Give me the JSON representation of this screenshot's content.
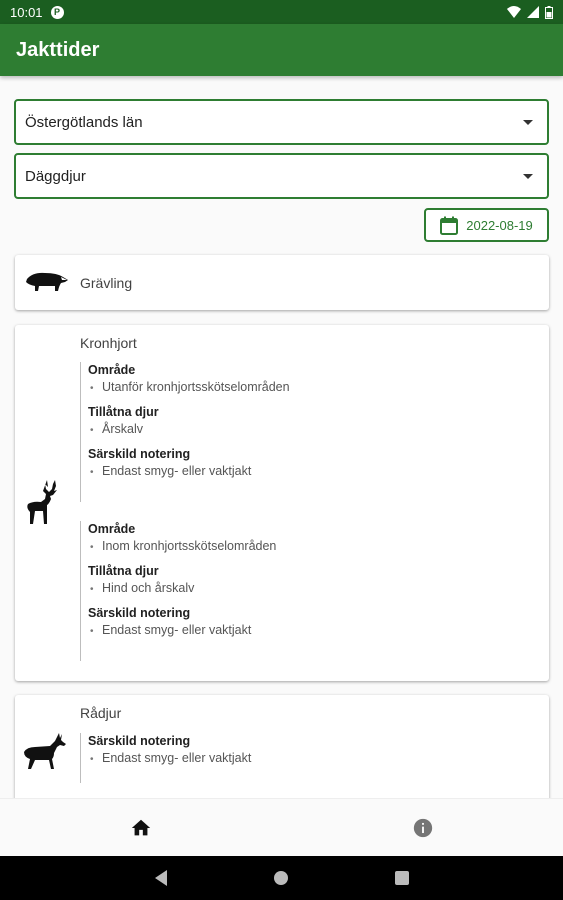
{
  "status_bar": {
    "time": "10:01",
    "app_badge": "P"
  },
  "app_bar": {
    "title": "Jakttider"
  },
  "filters": {
    "region": "Östergötlands län",
    "category": "Däggdjur",
    "date": "2022-08-19"
  },
  "icons": {
    "calendar": "calendar-icon",
    "home": "home-icon",
    "info": "info-icon",
    "dropdown": "arrow-drop-down-icon"
  },
  "colors": {
    "primary": "#2e7d32",
    "status_bar": "#1b5e20"
  },
  "species": [
    {
      "name": "Grävling",
      "icon": "badger-icon",
      "rules": []
    },
    {
      "name": "Kronhjort",
      "icon": "red-deer-icon",
      "rules": [
        {
          "area_label": "Område",
          "area": "Utanför kronhjortsskötselområden",
          "animals_label": "Tillåtna djur",
          "animals": "Årskalv",
          "note_label": "Särskild notering",
          "note": "Endast smyg- eller vaktjakt"
        },
        {
          "area_label": "Område",
          "area": "Inom kronhjortsskötselområden",
          "animals_label": "Tillåtna djur",
          "animals": "Hind och årskalv",
          "note_label": "Särskild notering",
          "note": "Endast smyg- eller vaktjakt"
        }
      ]
    },
    {
      "name": "Rådjur",
      "icon": "roe-deer-icon",
      "rules": [
        {
          "note_label": "Särskild notering",
          "note": "Endast smyg- eller vaktjakt"
        }
      ]
    }
  ]
}
